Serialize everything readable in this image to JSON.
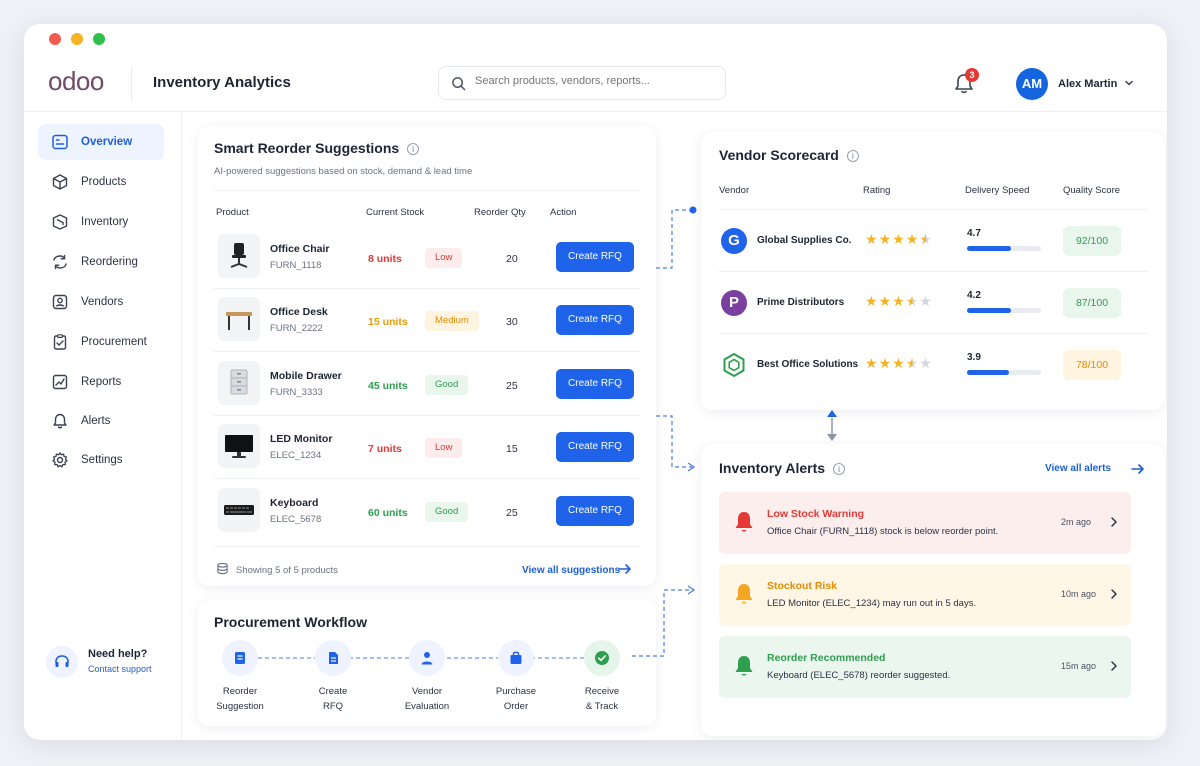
{
  "window": {
    "dot_colors": [
      "#f05a4f",
      "#f5b324",
      "#2fbf4a"
    ]
  },
  "header": {
    "logo": "odoo",
    "title": "Inventory Analytics",
    "search_placeholder": "Search products, vendors, reports...",
    "notification_count": "3",
    "user_initials": "AM",
    "user_name": "Alex Martin"
  },
  "sidebar": {
    "items": [
      {
        "label": "Overview",
        "icon": "overview-icon",
        "active": true
      },
      {
        "label": "Products",
        "icon": "cube-icon"
      },
      {
        "label": "Inventory",
        "icon": "box-icon"
      },
      {
        "label": "Reordering",
        "icon": "refresh-icon"
      },
      {
        "label": "Vendors",
        "icon": "vendor-icon"
      },
      {
        "label": "Procurement",
        "icon": "clipboard-icon"
      },
      {
        "label": "Reports",
        "icon": "chart-icon"
      },
      {
        "label": "Alerts",
        "icon": "bell-icon"
      },
      {
        "label": "Settings",
        "icon": "gear-icon"
      }
    ],
    "help": {
      "title": "Need help?",
      "link": "Contact support"
    }
  },
  "reorder": {
    "title": "Smart Reorder Suggestions",
    "subtitle": "AI-powered suggestions based on stock, demand & lead time",
    "columns": [
      "Product",
      "Current Stock",
      "Reorder Qty",
      "Action"
    ],
    "rows": [
      {
        "name": "Office Chair",
        "sku": "FURN_1118",
        "stock": "8 units",
        "status": "Low",
        "qty": "20",
        "action": "Create RFQ",
        "thumb": "chair-thumbnail"
      },
      {
        "name": "Office Desk",
        "sku": "FURN_2222",
        "stock": "15 units",
        "status": "Medium",
        "qty": "30",
        "action": "Create RFQ",
        "thumb": "desk-thumbnail"
      },
      {
        "name": "Mobile Drawer",
        "sku": "FURN_3333",
        "stock": "45 units",
        "status": "Good",
        "qty": "25",
        "action": "Create RFQ",
        "thumb": "drawer-thumbnail"
      },
      {
        "name": "LED Monitor",
        "sku": "ELEC_1234",
        "stock": "7 units",
        "status": "Low",
        "qty": "15",
        "action": "Create RFQ",
        "thumb": "monitor-thumbnail"
      },
      {
        "name": "Keyboard",
        "sku": "ELEC_5678",
        "stock": "60 units",
        "status": "Good",
        "qty": "25",
        "action": "Create RFQ",
        "thumb": "keyboard-thumbnail"
      }
    ],
    "footer_note": "Showing 5 of 5 products",
    "footer_link": "View all suggestions"
  },
  "workflow": {
    "title": "Procurement Workflow",
    "steps": [
      {
        "line1": "Reorder",
        "line2": "Suggestion"
      },
      {
        "line1": "Create",
        "line2": "RFQ"
      },
      {
        "line1": "Vendor",
        "line2": "Evaluation"
      },
      {
        "line1": "Purchase",
        "line2": "Order"
      },
      {
        "line1": "Receive",
        "line2": "& Track"
      }
    ]
  },
  "vendors": {
    "title": "Vendor Scorecard",
    "columns": [
      "Vendor",
      "Rating",
      "Delivery Speed",
      "Quality Score"
    ],
    "rows": [
      {
        "name": "Global Supplies Co.",
        "logo": "G",
        "rating": 4.5,
        "speed": "4.7",
        "speed_fraction": 0.59,
        "quality": "92/100"
      },
      {
        "name": "Prime Distributors",
        "logo": "P",
        "rating": 3.5,
        "speed": "4.2",
        "speed_fraction": 0.59,
        "quality": "87/100"
      },
      {
        "name": "Best Office Solutions",
        "logo": "hex",
        "rating": 3.5,
        "speed": "3.9",
        "speed_fraction": 0.57,
        "quality": "78/100"
      }
    ]
  },
  "alerts": {
    "title": "Inventory Alerts",
    "view_all": "View all alerts",
    "items": [
      {
        "title": "Low Stock Warning",
        "desc": "Office Chair (FURN_1118) stock is below reorder point.",
        "time": "2m ago",
        "level": "danger"
      },
      {
        "title": "Stockout Risk",
        "desc": "LED Monitor (ELEC_1234) may run out in 5 days.",
        "time": "10m ago",
        "level": "warning"
      },
      {
        "title": "Reorder Recommended",
        "desc": "Keyboard (ELEC_5678) reorder suggested.",
        "time": "15m ago",
        "level": "success"
      }
    ]
  },
  "colors": {
    "primary": "#1e63e9",
    "danger": "#e53935",
    "warning": "#f29900",
    "success": "#2e9e4f",
    "star": "#f5b324",
    "brand": "#714b67"
  }
}
